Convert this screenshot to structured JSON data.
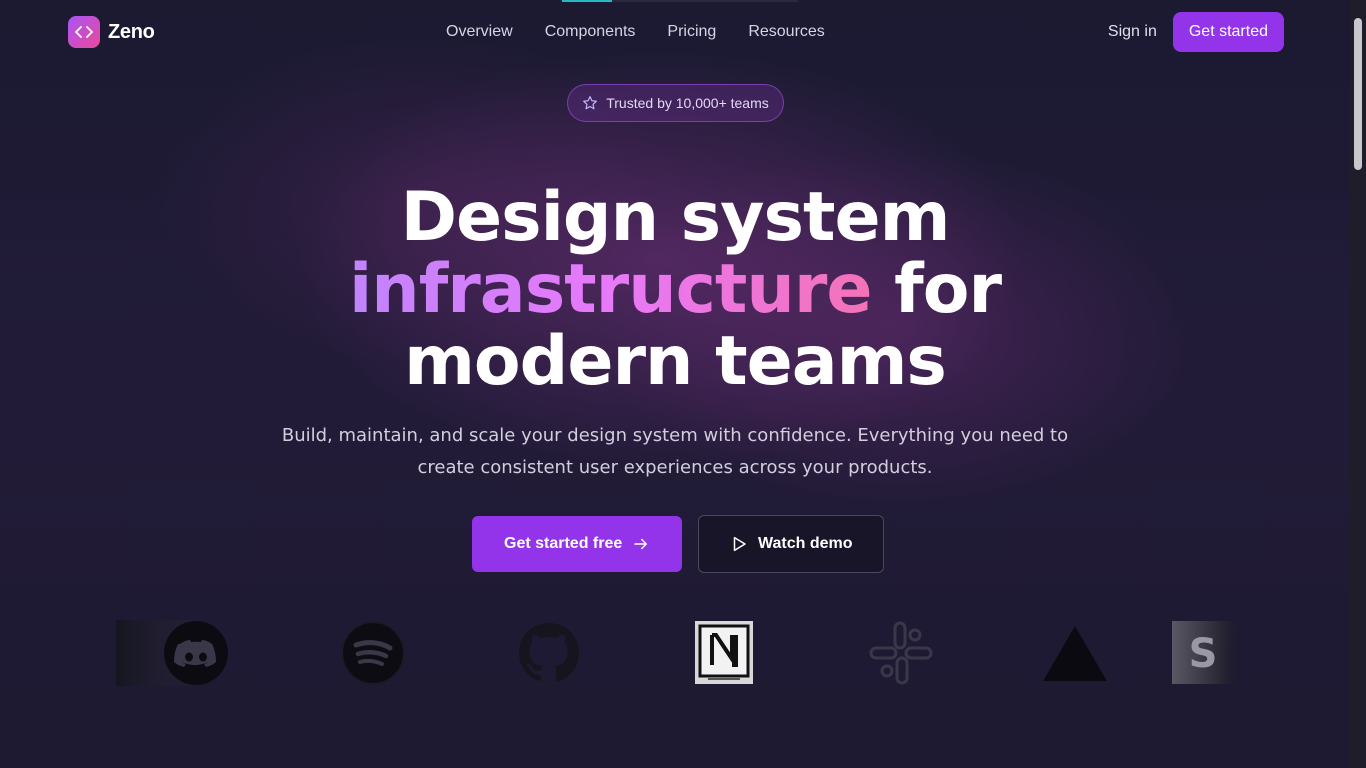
{
  "nav": {
    "brand": "Zeno",
    "brand_icon": "code-brackets-icon",
    "links": [
      "Overview",
      "Components",
      "Pricing",
      "Resources"
    ],
    "signin": "Sign in",
    "cta": "Get started"
  },
  "badge": {
    "icon": "star-icon",
    "text": "Trusted by 10,000+ teams"
  },
  "hero": {
    "line1": "Design system",
    "line2_highlight": "infrastructure",
    "line2_rest": " for",
    "line3": "modern teams",
    "subtitle": "Build, maintain, and scale your design system with confidence. Everything you need to create consistent user experiences across your products."
  },
  "cta": {
    "primary": "Get started free",
    "secondary": "Watch demo"
  },
  "logos": [
    "discord-logo",
    "spotify-logo",
    "github-logo",
    "notion-logo",
    "slack-logo",
    "vercel-logo",
    "stripe-logo"
  ],
  "colors": {
    "accent": "#9333ea",
    "gradient_start": "#c084fc",
    "gradient_end": "#f472b6",
    "background": "#1a1830"
  }
}
